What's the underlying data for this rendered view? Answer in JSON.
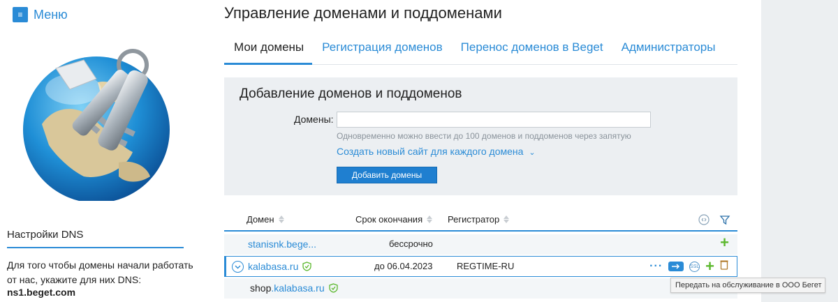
{
  "menu": {
    "label": "Меню",
    "icon": "hamburger-icon"
  },
  "header": {
    "title": "Управление доменами и поддоменами"
  },
  "tabs": [
    {
      "label": "Мои домены",
      "active": true
    },
    {
      "label": "Регистрация доменов",
      "active": false
    },
    {
      "label": "Перенос доменов в Beget",
      "active": false
    },
    {
      "label": "Администраторы",
      "active": false
    }
  ],
  "add_panel": {
    "title": "Добавление доменов и поддоменов",
    "domains_label": "Домены:",
    "input_value": "",
    "input_placeholder": "",
    "hint": "Одновременно можно ввести до 100 доменов и поддоменов через запятую",
    "create_site_link": "Создать новый сайт для каждого домена",
    "add_button": "Добавить домены"
  },
  "table": {
    "columns": [
      "Домен",
      "Срок окончания",
      "Регистратор"
    ],
    "rows": [
      {
        "domain": "stanisnk.bege...",
        "expires": "бессрочно",
        "registrar": ""
      },
      {
        "domain": "kalabasa.ru",
        "expires": "до 06.04.2023",
        "registrar": "REGTIME-RU"
      }
    ],
    "subdomain": {
      "host": "shop",
      "rest": ".kalabasa.ru"
    }
  },
  "tooltip": {
    "text": "Передать на обслуживание в ООО Бегет"
  },
  "sidebar": {
    "dns_title": "Настройки DNS",
    "dns_text": "Для того чтобы домены начали работать от нас, укажите для них DNS:",
    "dns_ns": "ns1.beget.com"
  },
  "icon_labels": {
    "ssl": "SSL"
  },
  "colors": {
    "accent": "#2a8bd6",
    "green": "#5cb82e",
    "panel": "#eceff2"
  }
}
